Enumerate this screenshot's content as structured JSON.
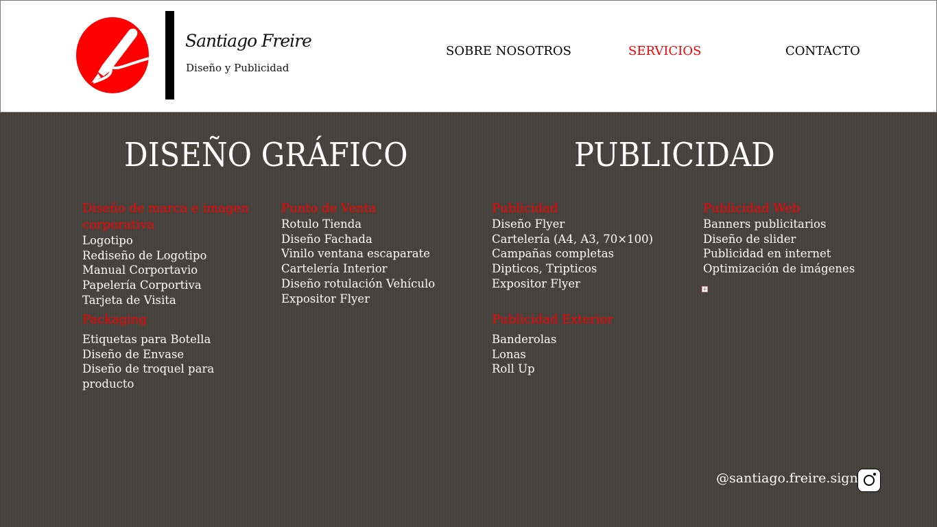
{
  "brand": {
    "name": "Santiago Freire",
    "tagline": "Diseño y Publicidad"
  },
  "nav": [
    {
      "label": "SOBRE NOSOTROS"
    },
    {
      "label": "SERVICIOS"
    },
    {
      "label": "CONTACTO"
    }
  ],
  "sections": {
    "diseno": "DISEÑO GRÁFICO",
    "publicidad": "PUBLICIDAD"
  },
  "groups": [
    {
      "title": "Diseño de marca e imagen corporativa",
      "items": [
        "Logotipo",
        "Rediseño de Logotipo",
        "Manual Corportavio",
        "Papelería Corportiva",
        "Tarjeta de Visita"
      ]
    },
    {
      "title": "Packaging",
      "items": [
        "Etiquetas para Botella",
        "Diseño de Envase",
        "Diseño de troquel para producto"
      ]
    },
    {
      "title": "Punto de Venta",
      "items": [
        "Rotulo Tienda",
        "Diseño Fachada",
        "Vinilo ventana escaparate",
        "Cartelería Interior",
        "Diseño rotulación Vehículo",
        "Expositor Flyer"
      ]
    },
    {
      "title": "Publicidad",
      "items": [
        "Diseño Flyer",
        "Cartelería (A4, A3, 70×100)",
        "Campañas completas",
        "Dipticos, Tripticos",
        "Expositor Flyer"
      ]
    },
    {
      "title": "Publicidad Exterior",
      "items": [
        "Banderolas",
        "Lonas",
        "Roll Up"
      ]
    },
    {
      "title": "Publicidad Web",
      "items": [
        "Banners publicitarios",
        "Diseño de slider",
        "Publicidad en internet",
        "Optimización de imágenes"
      ]
    }
  ],
  "footer": {
    "instagram": "@santiago.freire.sign"
  },
  "colors": {
    "accent": "#ff0000",
    "background": "#46433f"
  }
}
